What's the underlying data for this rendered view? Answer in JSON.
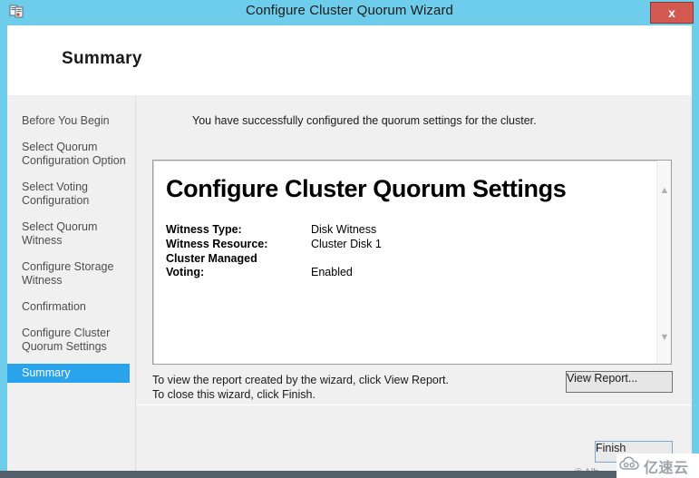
{
  "window": {
    "title": "Configure Cluster Quorum Wizard",
    "icon": "cluster-icon",
    "close_label": "x",
    "titlebar_color": "#6fcdec",
    "close_color": "#d3584f"
  },
  "banner": {
    "heading": "Summary"
  },
  "sidebar": {
    "items": [
      {
        "label": "Before You Begin",
        "selected": false
      },
      {
        "label": "Select Quorum\nConfiguration Option",
        "selected": false
      },
      {
        "label": "Select Voting\nConfiguration",
        "selected": false
      },
      {
        "label": "Select Quorum\nWitness",
        "selected": false
      },
      {
        "label": "Configure Storage\nWitness",
        "selected": false
      },
      {
        "label": "Confirmation",
        "selected": false
      },
      {
        "label": "Configure Cluster\nQuorum Settings",
        "selected": false
      },
      {
        "label": "Summary",
        "selected": true
      }
    ],
    "selected_color": "#29a3ec"
  },
  "main": {
    "intro_text": "You have successfully configured the quorum settings for the cluster.",
    "report": {
      "title": "Configure Cluster Quorum Settings",
      "rows": [
        {
          "label": "Witness Type:",
          "value": "Disk Witness"
        },
        {
          "label": "Witness Resource:",
          "value": "Cluster Disk 1"
        },
        {
          "label": "Cluster Managed\nVoting:",
          "value": "Enabled"
        }
      ],
      "scroll_up_icon": "chevron-up-icon",
      "scroll_down_icon": "chevron-down-icon"
    },
    "hint_line_1": "To view the report created by the wizard, click View Report.",
    "hint_line_2": "To close this wizard, click Finish.",
    "view_report_label": "View Report..."
  },
  "footer": {
    "finish_label": "Finish",
    "copyright": "© Alb"
  },
  "watermark": {
    "text": "亿速云",
    "logo": "cloud-icon"
  }
}
